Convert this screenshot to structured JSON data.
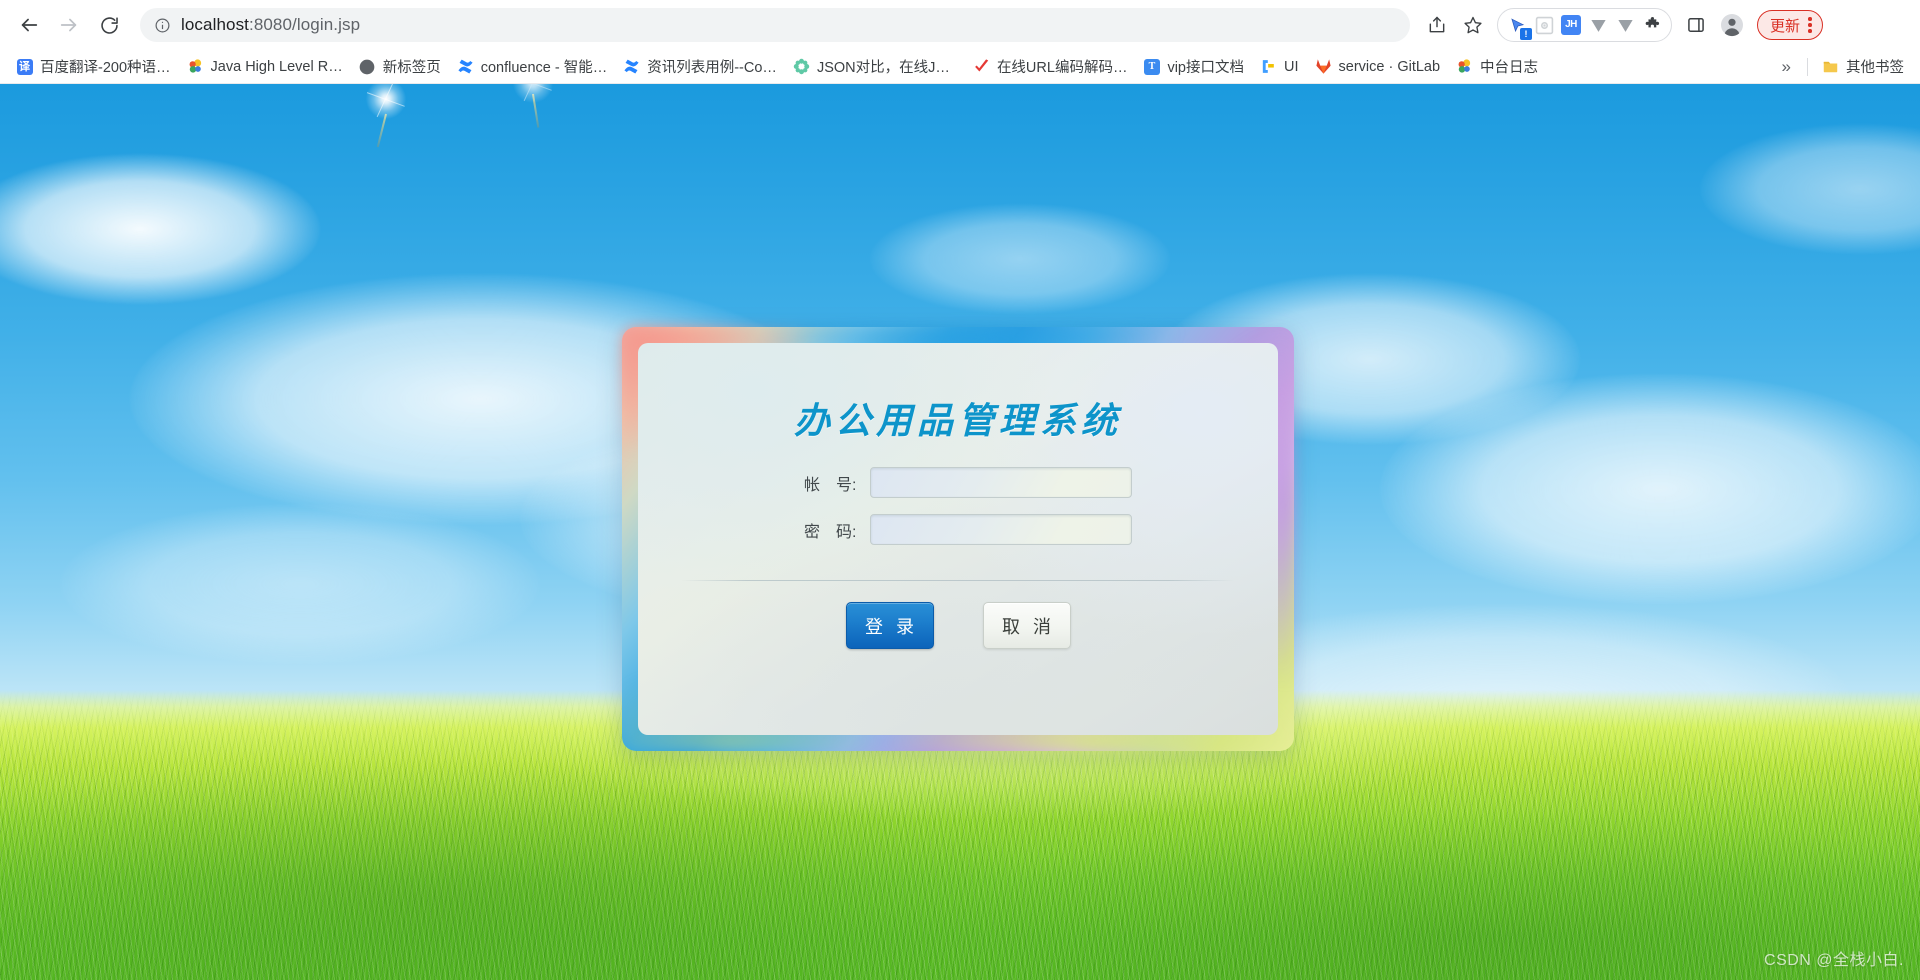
{
  "browser": {
    "back_label": "Back",
    "forward_label": "Forward",
    "reload_label": "Reload",
    "site_info_label": "View site information",
    "url_prefix": "localhost",
    "url_suffix": ":8080/login.jsp",
    "url_full": "localhost:8080/login.jsp",
    "share_label": "Share this page",
    "bookmark_label": "Bookmark this tab",
    "extensions_label": "Extensions",
    "side_panel_label": "Side panel",
    "profile_label": "Profile",
    "update_label": "更新",
    "menu_label": "Customize and control Google Chrome",
    "ext_items": [
      {
        "name": "pointer-extension-icon",
        "badge": "!"
      },
      {
        "name": "qr-code-extension-icon",
        "badge": ""
      },
      {
        "name": "jh-extension-icon",
        "badge": "JH"
      },
      {
        "name": "download-v-extension-icon",
        "badge": ""
      },
      {
        "name": "download-v2-extension-icon",
        "badge": ""
      },
      {
        "name": "puzzle-extensions-icon",
        "badge": ""
      }
    ]
  },
  "bookmarks": {
    "items": [
      {
        "label": "百度翻译-200种语…",
        "icon": "译",
        "icon_bg": "#3b7cf6",
        "icon_type": "square"
      },
      {
        "label": "Java High Level R…",
        "icon": "",
        "icon_bg": "#f5c518",
        "icon_type": "cluster"
      },
      {
        "label": "新标签页",
        "icon": "",
        "icon_bg": "#5f6368",
        "icon_type": "circle"
      },
      {
        "label": "confluence - 智能…",
        "icon": "",
        "icon_bg": "#2684ff",
        "icon_type": "x"
      },
      {
        "label": "资讯列表用例--Co…",
        "icon": "",
        "icon_bg": "#2684ff",
        "icon_type": "x"
      },
      {
        "label": "JSON对比，在线JS…",
        "icon": "",
        "icon_bg": "#5fc9a6",
        "icon_type": "flower"
      },
      {
        "label": "在线URL编码解码…",
        "icon": "",
        "icon_bg": "#e53935",
        "icon_type": "check"
      },
      {
        "label": "vip接口文档",
        "icon": "T",
        "icon_bg": "#3b8bf0",
        "icon_type": "square"
      },
      {
        "label": "UI",
        "icon": "",
        "icon_bg": "#3b8bf0",
        "icon_type": "ui"
      },
      {
        "label": "service · GitLab",
        "icon": "",
        "icon_bg": "#e24329",
        "icon_type": "fox"
      },
      {
        "label": "中台日志",
        "icon": "",
        "icon_bg": "#f5c518",
        "icon_type": "cluster"
      }
    ],
    "overflow_label": "»",
    "other_bookmarks_label": "其他书签",
    "other_bookmarks_icon": "folder-icon"
  },
  "login": {
    "title": "办公用品管理系统",
    "fields": [
      {
        "label": "帐　号:",
        "value": "",
        "placeholder": "",
        "type": "text",
        "name": "account"
      },
      {
        "label": "密　码:",
        "value": "",
        "placeholder": "",
        "type": "password",
        "name": "password"
      }
    ],
    "submit_label": "登 录",
    "cancel_label": "取 消"
  },
  "watermark": {
    "text": "CSDN @全栈小白."
  },
  "colors": {
    "title": "#0f94c8",
    "login_button": "#1f7fcb",
    "cancel_button": "#f2f5f0",
    "update_pill": "#d93025",
    "sky_top": "#1b9ade",
    "grass": "#8fd62c"
  }
}
